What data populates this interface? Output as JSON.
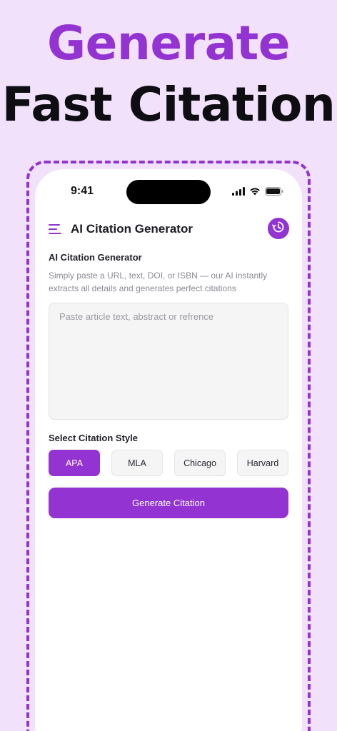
{
  "hero": {
    "line1": "Generate",
    "line2": "Fast Citation"
  },
  "status_bar": {
    "time": "9:41"
  },
  "header": {
    "title": "AI Citation Generator"
  },
  "section": {
    "title": "AI Citation Generator",
    "description": "Simply paste a URL, text, DOI, or ISBN — our AI instantly extracts all details and generates perfect citations"
  },
  "input": {
    "placeholder": "Paste article text, abstract or refrence",
    "value": ""
  },
  "citation_style": {
    "label": "Select Citation Style",
    "options": [
      "APA",
      "MLA",
      "Chicago",
      "Harvard"
    ],
    "selected": "APA"
  },
  "generate_button": {
    "label": "Generate Citation"
  },
  "colors": {
    "accent": "#9233d2",
    "background": "#f2e1fb",
    "hero_dark": "#0d0d12"
  },
  "icons": [
    "menu-icon",
    "history-icon",
    "signal-icon",
    "wifi-icon",
    "battery-icon"
  ]
}
